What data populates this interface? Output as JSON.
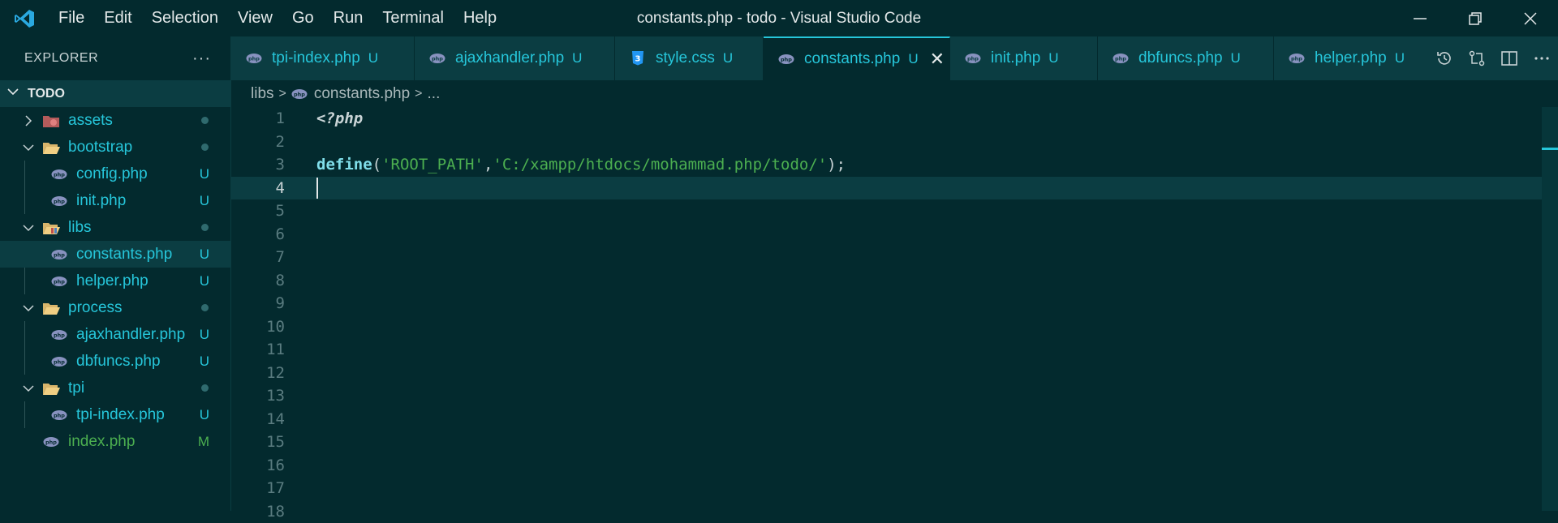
{
  "window": {
    "title": "constants.php - todo - Visual Studio Code"
  },
  "menu": [
    "File",
    "Edit",
    "Selection",
    "View",
    "Go",
    "Run",
    "Terminal",
    "Help"
  ],
  "sidebar": {
    "header": "EXPLORER",
    "more": "···",
    "section": "TODO",
    "items": [
      {
        "label": "assets",
        "icon": "folder-assets-icon",
        "status": "dot"
      },
      {
        "label": "bootstrap",
        "icon": "folder-icon",
        "status": "dot"
      },
      {
        "label": "config.php",
        "icon": "php-file-icon",
        "status": "U"
      },
      {
        "label": "init.php",
        "icon": "php-file-icon",
        "status": "U"
      },
      {
        "label": "libs",
        "icon": "folder-libs-icon",
        "status": "dot"
      },
      {
        "label": "constants.php",
        "icon": "php-file-icon",
        "status": "U"
      },
      {
        "label": "helper.php",
        "icon": "php-file-icon",
        "status": "U"
      },
      {
        "label": "process",
        "icon": "folder-icon",
        "status": "dot"
      },
      {
        "label": "ajaxhandler.php",
        "icon": "php-file-icon",
        "status": "U"
      },
      {
        "label": "dbfuncs.php",
        "icon": "php-file-icon",
        "status": "U"
      },
      {
        "label": "tpi",
        "icon": "folder-icon",
        "status": "dot"
      },
      {
        "label": "tpi-index.php",
        "icon": "php-file-icon",
        "status": "U"
      },
      {
        "label": "index.php",
        "icon": "php-file-icon",
        "status": "M"
      }
    ]
  },
  "tabs": [
    {
      "label": "tpi-index.php",
      "status": "U",
      "icon": "php-file-icon"
    },
    {
      "label": "ajaxhandler.php",
      "status": "U",
      "icon": "php-file-icon"
    },
    {
      "label": "style.css",
      "status": "U",
      "icon": "css-file-icon"
    },
    {
      "label": "constants.php",
      "status": "U",
      "icon": "php-file-icon",
      "close": "✕"
    },
    {
      "label": "init.php",
      "status": "U",
      "icon": "php-file-icon"
    },
    {
      "label": "dbfuncs.php",
      "status": "U",
      "icon": "php-file-icon"
    },
    {
      "label": "helper.php",
      "status": "U",
      "icon": "php-file-icon"
    }
  ],
  "breadcrumb": {
    "folder": "libs",
    "file": "constants.php",
    "more": "..."
  },
  "editor": {
    "line_numbers": [
      "1",
      "2",
      "3",
      "4",
      "5",
      "6",
      "7",
      "8",
      "9",
      "10",
      "11",
      "12",
      "13",
      "14",
      "15",
      "16",
      "17",
      "18"
    ],
    "line1": "<?php",
    "line3": {
      "fn": "define",
      "open": "(",
      "arg1": "'ROOT_PATH'",
      "comma": ",",
      "arg2": "'C:/xampp/htdocs/mohammad.php/todo/'",
      "close": ");"
    }
  },
  "colors": {
    "background": "#032a2e",
    "accent": "#26c6da",
    "modified": "#4caf50",
    "panel": "#0b3d42"
  }
}
